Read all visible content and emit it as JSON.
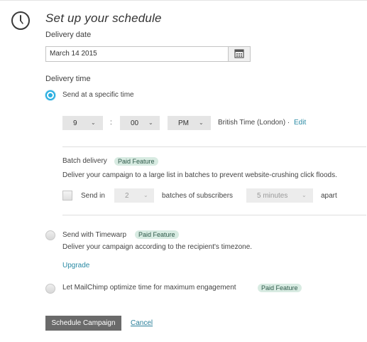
{
  "header": {
    "title": "Set up your schedule",
    "icon": "clock-icon"
  },
  "delivery_date": {
    "label": "Delivery date",
    "value": "March 14 2015",
    "icon": "calendar-icon"
  },
  "delivery_time": {
    "label": "Delivery time",
    "specific": {
      "label": "Send at a specific time",
      "hour": "9",
      "separator": ":",
      "minute": "00",
      "ampm": "PM",
      "timezone": "British Time (London) ·",
      "edit_label": "Edit"
    },
    "batch": {
      "title": "Batch delivery",
      "badge": "Paid Feature",
      "description": "Deliver your campaign to a large list in batches to prevent website-crushing click floods.",
      "send_in": "Send in",
      "count": "2",
      "batches_text": "batches of subscribers",
      "interval": "5 minutes",
      "apart": "apart"
    },
    "timewarp": {
      "label": "Send with Timewarp",
      "badge": "Paid Feature",
      "description": "Deliver your campaign according to the recipient's timezone.",
      "upgrade_label": "Upgrade"
    },
    "optimize": {
      "label": "Let MailChimp optimize time for maximum engagement",
      "badge": "Paid Feature"
    }
  },
  "actions": {
    "schedule_label": "Schedule Campaign",
    "cancel_label": "Cancel"
  },
  "colors": {
    "accent": "#28aee0",
    "link": "#2a8aa4",
    "badge_bg": "#d8ebe2",
    "primary_button": "#6a6a6a"
  }
}
